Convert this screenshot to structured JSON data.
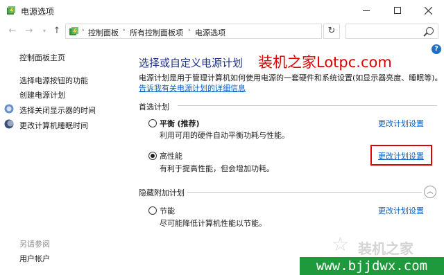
{
  "window": {
    "title": "电源选项",
    "icon": "power-options-icon"
  },
  "address": {
    "crumbs": [
      "控制面板",
      "所有控制面板项",
      "电源选项"
    ],
    "search_placeholder": ""
  },
  "sidebar": {
    "items": [
      {
        "label": "控制面板主页",
        "icon": null
      },
      {
        "label": "选择电源按钮的功能",
        "icon": null
      },
      {
        "label": "创建电源计划",
        "icon": null
      },
      {
        "label": "选择关闭显示器的时间",
        "icon": "display-icon"
      },
      {
        "label": "更改计算机睡眠时间",
        "icon": "moon-icon"
      }
    ],
    "see_also": "另请参阅",
    "user_accounts": "用户帐户"
  },
  "main": {
    "title": "选择或自定义电源计划",
    "description": "电源计划是用于管理计算机如何使用电源的一套硬件和系统设置(如显示器亮度、睡眠等)。",
    "more_info_link": "告诉我有关电源计划的详细信息",
    "preferred_heading": "首选计划",
    "hidden_heading": "隐藏附加计划",
    "plans": [
      {
        "name": "平衡",
        "tag": "(推荐)",
        "desc": "利用可用的硬件自动平衡功耗与性能。",
        "selected": false,
        "link": "更改计划设置"
      },
      {
        "name": "高性能",
        "tag": "",
        "desc": "有利于提高性能，但会增加功耗。",
        "selected": true,
        "link": "更改计划设置"
      },
      {
        "name": "节能",
        "tag": "",
        "desc": "尽可能降低计算机性能以节能。",
        "selected": false,
        "link": "更改计划设置"
      }
    ]
  },
  "watermarks": {
    "top": "装机之家Lotpc.com",
    "bottom_cn": "装机之家",
    "bottom_url": "www.bjjdwx.com"
  },
  "colors": {
    "title_blue": "#1e3287",
    "link_blue": "#0a5fc5",
    "highlight_red": "#e00000",
    "url_green": "#1e9a3c"
  }
}
